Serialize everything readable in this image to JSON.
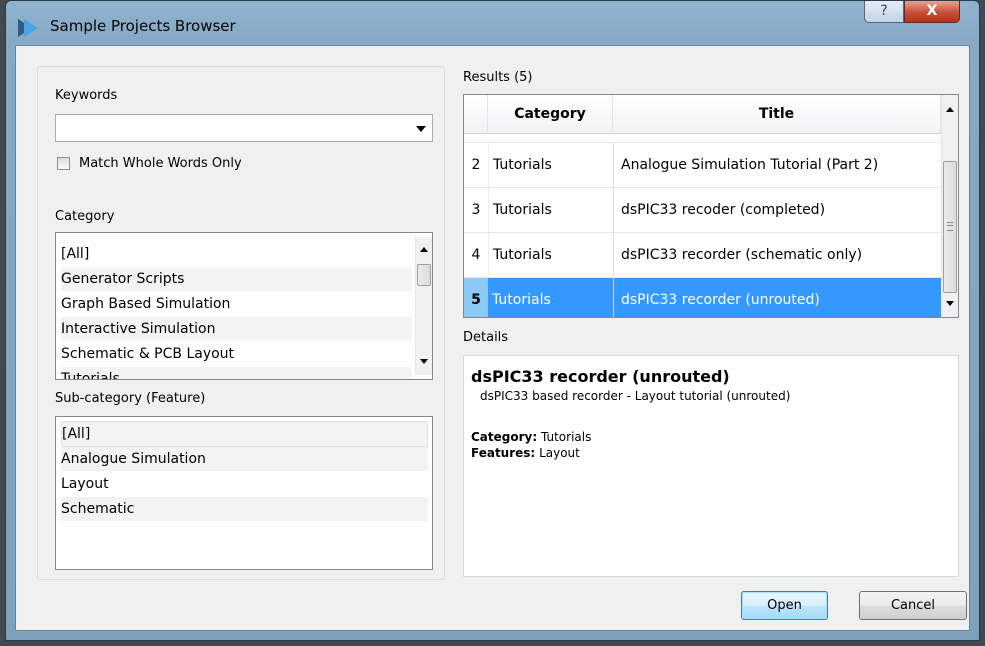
{
  "window": {
    "title": "Sample Projects Browser",
    "help_glyph": "?",
    "close_glyph": "X"
  },
  "left": {
    "keywords_label": "Keywords",
    "keywords_value": "",
    "match_whole_words_label": "Match Whole Words Only",
    "match_whole_words_checked": false,
    "category_label": "Category",
    "category_items": [
      "[All]",
      "Generator Scripts",
      "Graph Based Simulation",
      "Interactive Simulation",
      "Schematic & PCB Layout",
      "Tutorials"
    ],
    "subcategory_label": "Sub-category (Feature)",
    "subcategory_items": [
      "[All]",
      "Analogue Simulation",
      "Layout",
      "Schematic"
    ]
  },
  "results": {
    "label": "Results (5)",
    "columns": [
      "Category",
      "Title"
    ],
    "rows": [
      {
        "num": "2",
        "category": "Tutorials",
        "title": "Analogue Simulation Tutorial (Part 2)"
      },
      {
        "num": "3",
        "category": "Tutorials",
        "title": "dsPIC33 recoder (completed)"
      },
      {
        "num": "4",
        "category": "Tutorials",
        "title": "dsPIC33 recorder (schematic only)"
      },
      {
        "num": "5",
        "category": "Tutorials",
        "title": "dsPIC33 recorder (unrouted)"
      }
    ],
    "selected_num": "5"
  },
  "details": {
    "label": "Details",
    "title": "dsPIC33 recorder (unrouted)",
    "description": "dsPIC33 based recorder - Layout tutorial (unrouted)",
    "category_key": "Category:",
    "category_value": "Tutorials",
    "features_key": "Features:",
    "features_value": "Layout"
  },
  "buttons": {
    "open": "Open",
    "cancel": "Cancel"
  },
  "colors": {
    "selection": "#3399ff",
    "selection_number_cell": "#8ccaf5",
    "title_bar": "#8fb3cf"
  },
  "icons": {
    "app": "proteus-app-icon",
    "dropdown": "dropdown-arrow-icon",
    "scroll_up": "scroll-up-arrow-icon",
    "scroll_down": "scroll-down-arrow-icon"
  }
}
